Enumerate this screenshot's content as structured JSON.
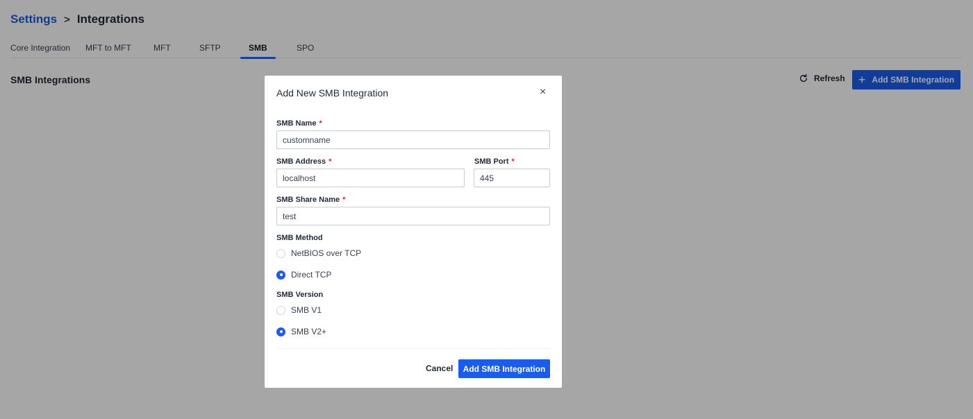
{
  "breadcrumb": {
    "root": "Settings",
    "separator": ">",
    "current": "Integrations"
  },
  "tabs": [
    {
      "label": "Core Integration",
      "active": false
    },
    {
      "label": "MFT to MFT",
      "active": false
    },
    {
      "label": "MFT",
      "active": false
    },
    {
      "label": "SFTP",
      "active": false
    },
    {
      "label": "SMB",
      "active": true
    },
    {
      "label": "SPO",
      "active": false
    }
  ],
  "section": {
    "title": "SMB Integrations"
  },
  "toolbar": {
    "refresh_label": "Refresh",
    "refresh_icon": "refresh-icon",
    "add_label": "Add SMB Integration",
    "add_icon": "+"
  },
  "modal": {
    "title": "Add New SMB Integration",
    "close_icon": "×",
    "required_marker": "*",
    "fields": {
      "name": {
        "label": "SMB Name",
        "value": "customname"
      },
      "address": {
        "label": "SMB Address",
        "value": "localhost"
      },
      "port": {
        "label": "SMB Port",
        "value": "445"
      },
      "share": {
        "label": "SMB Share Name",
        "value": "test"
      }
    },
    "method": {
      "label": "SMB Method",
      "options": [
        {
          "label": "NetBIOS over TCP",
          "checked": false
        },
        {
          "label": "Direct TCP",
          "checked": true
        }
      ]
    },
    "version": {
      "label": "SMB Version",
      "options": [
        {
          "label": "SMB V1",
          "checked": false
        },
        {
          "label": "SMB V2+",
          "checked": true
        }
      ]
    },
    "cancel_label": "Cancel",
    "submit_label": "Add SMB Integration"
  },
  "colors": {
    "primary": "#1a5cf0",
    "link": "#1d5fd6",
    "required": "#dc2626",
    "overlay": "rgba(0,0,0,0.35)"
  }
}
